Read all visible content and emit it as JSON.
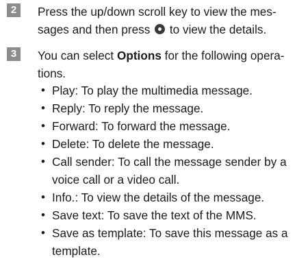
{
  "step2": {
    "number": "2",
    "line1": "Press the up/down scroll key to view the mes-",
    "line2_before": "sages and then press ",
    "key_icon": "center-key-icon",
    "line2_after": " to view the details."
  },
  "step3": {
    "number": "3",
    "line1_before": "You can select ",
    "line1_bold": "Options",
    "line1_after": " for the following opera-",
    "line2": "tions."
  },
  "bullets": [
    {
      "lines": [
        "Play: To play the multimedia message."
      ]
    },
    {
      "lines": [
        "Reply: To reply the message."
      ]
    },
    {
      "lines": [
        "Forward: To forward the message."
      ]
    },
    {
      "lines": [
        "Delete: To delete the message."
      ]
    },
    {
      "lines": [
        "Call sender: To call the message sender by a",
        "voice call or a video call."
      ]
    },
    {
      "lines": [
        "Info.: To view the details of the message."
      ]
    },
    {
      "lines": [
        "Save text: To save the text of the MMS."
      ]
    },
    {
      "lines": [
        "Save as template: To save this message as a",
        "template."
      ]
    }
  ],
  "bullet_char": "•",
  "colors": {
    "step_badge": "#8c8c8c",
    "text": "#1a1a1a"
  }
}
